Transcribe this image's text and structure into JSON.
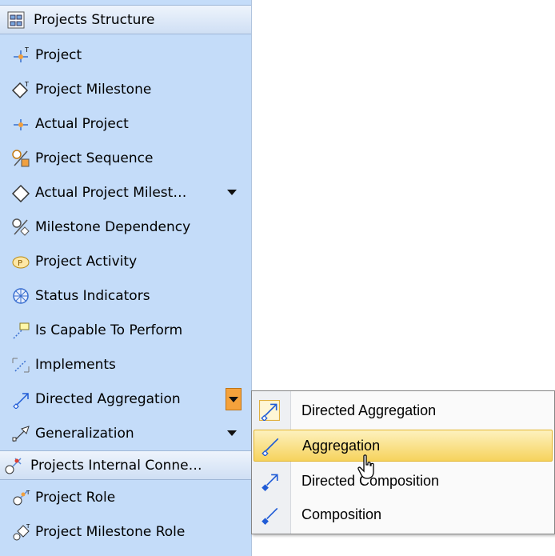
{
  "palette": {
    "groups": [
      {
        "header": "Projects Structure",
        "items": [
          {
            "label": "Project",
            "icon": "project-icon"
          },
          {
            "label": "Project Milestone",
            "icon": "project-milestone-icon"
          },
          {
            "label": "Actual Project",
            "icon": "actual-project-icon"
          },
          {
            "label": "Project Sequence",
            "icon": "project-sequence-icon"
          },
          {
            "label": "Actual Project Milest…",
            "icon": "actual-project-milestone-icon"
          },
          {
            "label": "Milestone Dependency",
            "icon": "milestone-dependency-icon"
          },
          {
            "label": "Project Activity",
            "icon": "project-activity-icon"
          },
          {
            "label": "Status Indicators",
            "icon": "status-indicators-icon"
          },
          {
            "label": "Is Capable To Perform",
            "icon": "is-capable-to-perform-icon"
          },
          {
            "label": "Implements",
            "icon": "implements-icon"
          },
          {
            "label": "Directed Aggregation",
            "icon": "directed-aggregation-icon"
          },
          {
            "label": "Generalization",
            "icon": "generalization-icon"
          }
        ]
      },
      {
        "header": "Projects Internal Conne…",
        "items": [
          {
            "label": "Project Role",
            "icon": "project-role-icon"
          },
          {
            "label": "Project Milestone Role",
            "icon": "project-milestone-role-icon"
          }
        ]
      }
    ]
  },
  "popup_menu": {
    "items": [
      {
        "label": "Directed Aggregation",
        "icon": "directed-aggregation-icon",
        "selected": false
      },
      {
        "label": "Aggregation",
        "icon": "aggregation-icon",
        "selected": true
      },
      {
        "label": "Directed Composition",
        "icon": "directed-composition-icon",
        "selected": false
      },
      {
        "label": "Composition",
        "icon": "composition-icon",
        "selected": false
      }
    ]
  },
  "colors": {
    "palette_bg": "#c4dcf9",
    "highlight": "#f6d35d",
    "split_button": "#f4a23c",
    "connector_blue": "#1f5bd6"
  }
}
